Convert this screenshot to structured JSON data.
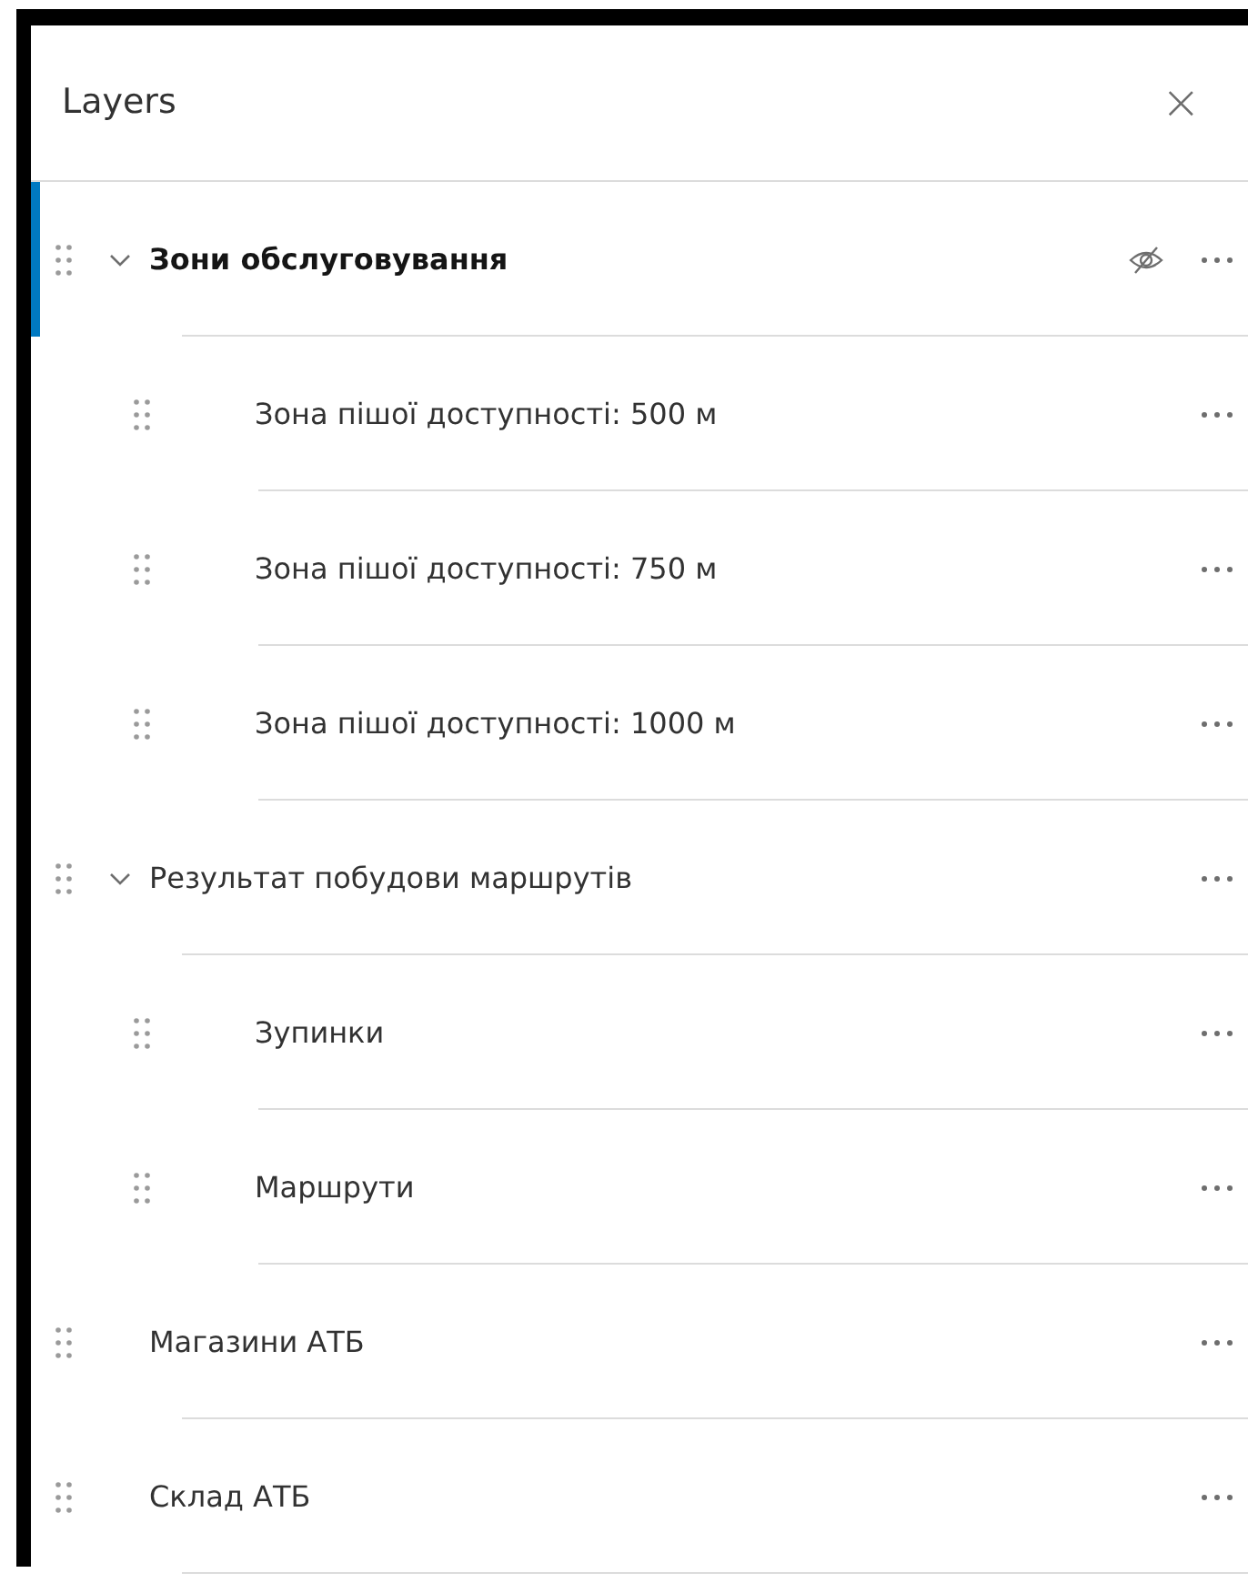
{
  "panel": {
    "title": "Layers",
    "close": "×"
  },
  "layers": [
    {
      "title": "Зони обслуговування",
      "selected": true,
      "expanded": true,
      "hidden": true,
      "children": [
        {
          "title": "Зона пішої доступності: 500 м",
          "selected": false,
          "hidden": false
        },
        {
          "title": "Зона пішої доступності: 750 м",
          "selected": false,
          "hidden": false
        },
        {
          "title": "Зона пішої доступності: 1000 м",
          "selected": false,
          "hidden": false
        }
      ]
    },
    {
      "title": "Результат побудови маршрутів",
      "selected": false,
      "expanded": true,
      "hidden": false,
      "children": [
        {
          "title": "Зупинки",
          "selected": false,
          "hidden": false
        },
        {
          "title": "Маршрути",
          "selected": false,
          "hidden": false
        }
      ]
    },
    {
      "title": "Магазини АТБ",
      "selected": false,
      "hidden": false
    },
    {
      "title": "Склад АТБ",
      "selected": false,
      "hidden": false
    }
  ]
}
